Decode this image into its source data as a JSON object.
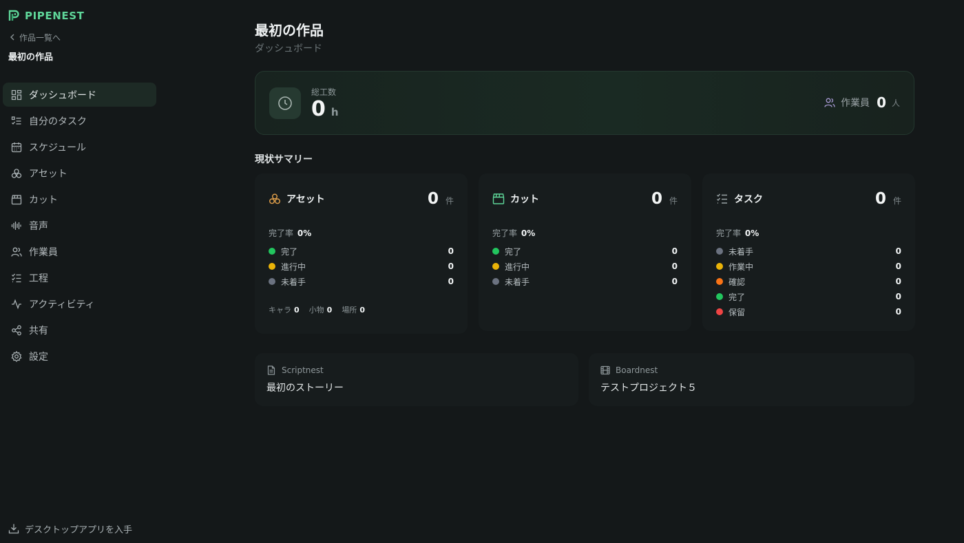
{
  "brand": {
    "name": "PIPENEST",
    "accent": "#5fd79a"
  },
  "sidebar": {
    "back_label": "作品一覧へ",
    "project_name": "最初の作品",
    "items": [
      {
        "label": "ダッシュボード",
        "icon": "dashboard-icon",
        "active": true
      },
      {
        "label": "自分のタスク",
        "icon": "my-tasks-icon"
      },
      {
        "label": "スケジュール",
        "icon": "calendar-icon"
      },
      {
        "label": "アセット",
        "icon": "asset-icon"
      },
      {
        "label": "カット",
        "icon": "clapperboard-icon"
      },
      {
        "label": "音声",
        "icon": "audio-wave-icon"
      },
      {
        "label": "作業員",
        "icon": "users-icon"
      },
      {
        "label": "工程",
        "icon": "process-list-icon"
      },
      {
        "label": "アクティビティ",
        "icon": "activity-icon"
      },
      {
        "label": "共有",
        "icon": "share-icon"
      },
      {
        "label": "設定",
        "icon": "gear-icon"
      }
    ],
    "download_label": "デスクトップアプリを入手"
  },
  "main": {
    "title": "最初の作品",
    "subtitle": "ダッシュボード",
    "summary_card": {
      "hours_label": "総工数",
      "hours_value": "0",
      "hours_unit": "h",
      "workers_label": "作業員",
      "workers_value": "0",
      "workers_unit": "人"
    },
    "section_title": "現状サマリー",
    "cards": [
      {
        "title": "アセット",
        "count": "0",
        "unit": "件",
        "rate_label": "完了率",
        "rate_value": "0%",
        "statuses": [
          {
            "label": "完了",
            "value": "0",
            "color": "#22c55e"
          },
          {
            "label": "進行中",
            "value": "0",
            "color": "#eab308"
          },
          {
            "label": "未着手",
            "value": "0",
            "color": "#6b7280"
          }
        ],
        "sub_counts": [
          {
            "label": "キャラ",
            "value": "0"
          },
          {
            "label": "小物",
            "value": "0"
          },
          {
            "label": "場所",
            "value": "0"
          }
        ]
      },
      {
        "title": "カット",
        "count": "0",
        "unit": "件",
        "rate_label": "完了率",
        "rate_value": "0%",
        "statuses": [
          {
            "label": "完了",
            "value": "0",
            "color": "#22c55e"
          },
          {
            "label": "進行中",
            "value": "0",
            "color": "#eab308"
          },
          {
            "label": "未着手",
            "value": "0",
            "color": "#6b7280"
          }
        ]
      },
      {
        "title": "タスク",
        "count": "0",
        "unit": "件",
        "rate_label": "完了率",
        "rate_value": "0%",
        "statuses": [
          {
            "label": "未着手",
            "value": "0",
            "color": "#6b7280"
          },
          {
            "label": "作業中",
            "value": "0",
            "color": "#eab308"
          },
          {
            "label": "確認",
            "value": "0",
            "color": "#f97316"
          },
          {
            "label": "完了",
            "value": "0",
            "color": "#22c55e"
          },
          {
            "label": "保留",
            "value": "0",
            "color": "#ef4444"
          }
        ]
      }
    ],
    "links": [
      {
        "service": "Scriptnest",
        "name": "最初のストーリー"
      },
      {
        "service": "Boardnest",
        "name": "テストプロジェクト５"
      }
    ]
  },
  "colors": {
    "background": "#141819",
    "card": "#171c1d",
    "asset_icon": "#e2a04a",
    "cut_icon": "#5fd79a",
    "task_icon": "#9aa3a6"
  }
}
